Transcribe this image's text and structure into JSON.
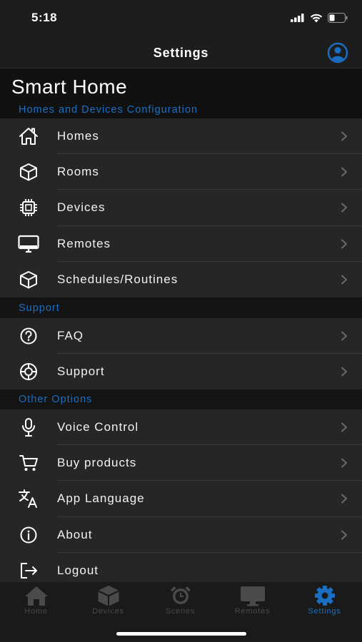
{
  "status": {
    "time": "5:18"
  },
  "nav": {
    "title": "Settings"
  },
  "app_title": "Smart Home",
  "sections": [
    {
      "header": "Homes and Devices Configuration",
      "items": [
        {
          "label": "Homes",
          "icon": "house-icon"
        },
        {
          "label": "Rooms",
          "icon": "cube-icon"
        },
        {
          "label": "Devices",
          "icon": "chip-icon"
        },
        {
          "label": "Remotes",
          "icon": "monitor-icon"
        },
        {
          "label": "Schedules/Routines",
          "icon": "cube-icon"
        }
      ]
    },
    {
      "header": "Support",
      "items": [
        {
          "label": "FAQ",
          "icon": "question-circle-icon"
        },
        {
          "label": "Support",
          "icon": "lifebuoy-icon"
        }
      ]
    },
    {
      "header": "Other Options",
      "items": [
        {
          "label": "Voice Control",
          "icon": "microphone-icon"
        },
        {
          "label": "Buy products",
          "icon": "cart-icon"
        },
        {
          "label": "App Language",
          "icon": "translate-icon"
        },
        {
          "label": "About",
          "icon": "info-circle-icon"
        },
        {
          "label": "Logout",
          "icon": "logout-icon"
        }
      ]
    }
  ],
  "tabs": [
    {
      "label": "Home",
      "icon": "home-tab-icon",
      "active": false
    },
    {
      "label": "Devices",
      "icon": "cube-tab-icon",
      "active": false
    },
    {
      "label": "Scenes",
      "icon": "alarm-clock-icon",
      "active": false
    },
    {
      "label": "Remotes",
      "icon": "monitor-tab-icon",
      "active": false
    },
    {
      "label": "Settings",
      "icon": "gear-tab-icon",
      "active": true
    }
  ],
  "colors": {
    "accent": "#1a6fc4",
    "background": "#111111",
    "row": "#262626",
    "tab_inactive": "#4a4a4a"
  }
}
